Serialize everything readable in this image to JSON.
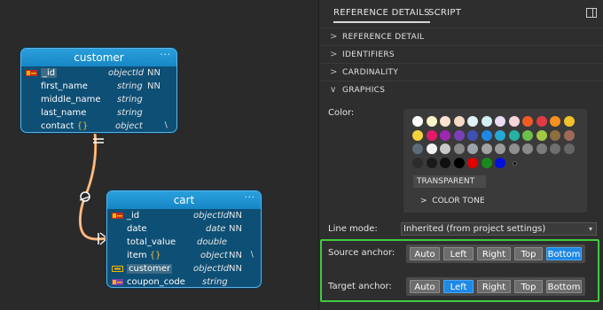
{
  "diagram": {
    "customer": {
      "title": "customer",
      "menu": "···",
      "fields": [
        {
          "name": "_id",
          "type": "objectId",
          "nn": "NN",
          "pk": true
        },
        {
          "name": "first_name",
          "type": "string",
          "nn": "NN"
        },
        {
          "name": "middle_name",
          "type": "string",
          "nn": ""
        },
        {
          "name": "last_name",
          "type": "string",
          "nn": ""
        },
        {
          "name": "contact",
          "brace": "{}",
          "type": "object",
          "nn": "",
          "mark": "∖"
        }
      ]
    },
    "cart": {
      "title": "cart",
      "menu": "···",
      "fields": [
        {
          "name": "_id",
          "type": "objectId",
          "nn": "NN",
          "pk": true
        },
        {
          "name": "date",
          "type": "date",
          "nn": "NN"
        },
        {
          "name": "total_value",
          "type": "double",
          "nn": ""
        },
        {
          "name": "item",
          "brace": "{}",
          "type": "object",
          "nn": "NN",
          "mark": "∖"
        },
        {
          "name": "customer",
          "type": "objectId",
          "nn": "NN",
          "fk": true
        },
        {
          "name": "coupon_code",
          "type": "string",
          "nn": "",
          "fk2": true
        }
      ]
    },
    "relation_color": "#f4a460"
  },
  "panel": {
    "tabs": [
      "REFERENCE DETAILS",
      "SCRIPT"
    ],
    "sections": [
      {
        "label": "REFERENCE DETAIL",
        "chevron": ">"
      },
      {
        "label": "IDENTIFIERS",
        "chevron": ">"
      },
      {
        "label": "CARDINALITY",
        "chevron": ">"
      },
      {
        "label": "GRAPHICS",
        "chevron": "∨"
      }
    ],
    "color_label": "Color:",
    "swatches": [
      [
        "#fdfdfd",
        "#fbf3c9",
        "#fbe3cf",
        "#f3d9c6",
        "#dff2f6",
        "#d2f0f3",
        "#e9dcf3",
        "#f7d3da",
        "#f15a24",
        "#e23a45",
        "#f7931e",
        "#f2c12e"
      ],
      [
        "#f4d23c",
        "#e6196a",
        "#9c27b0",
        "#7a3fb8",
        "#3f51b5",
        "#1e88e5",
        "#26a8d5",
        "#26b3a4",
        "#6cc04a",
        "#a5c843",
        "#8d6e3e",
        "#9e6b5a"
      ],
      [
        "#5d6b78",
        "#f2f2f2",
        "#c8c8c8",
        "#888888",
        "#9aa3a8",
        "#a3a3a3",
        "#9a9a9a",
        "#8f8f8f",
        "#8a8a8a",
        "#7b7b7b",
        "#6f6f6f",
        "#666666"
      ],
      [
        "#2c2c2c",
        "#1a1a1a",
        "#101010",
        "#000000",
        "#e00000",
        "#1a8a1a",
        "#0011dd",
        "#111111"
      ]
    ],
    "transparent_label": "TRANSPARENT",
    "color_tone_label": "COLOR TONE",
    "color_tone_chevron": ">",
    "line_mode_label": "Line mode:",
    "line_mode_value": "Inherited (from project settings)",
    "line_mode_arrow": "▾",
    "source_anchor_label": "Source anchor:",
    "source_anchor_options": [
      "Auto",
      "Left",
      "Right",
      "Top",
      "Bottom"
    ],
    "source_anchor_selected": "Bottom",
    "target_anchor_label": "Target anchor:",
    "target_anchor_options": [
      "Auto",
      "Left",
      "Right",
      "Top",
      "Bottom"
    ],
    "target_anchor_selected": "Left",
    "highlight_color": "#3fcc3f",
    "accent_color": "#1e88e5"
  }
}
